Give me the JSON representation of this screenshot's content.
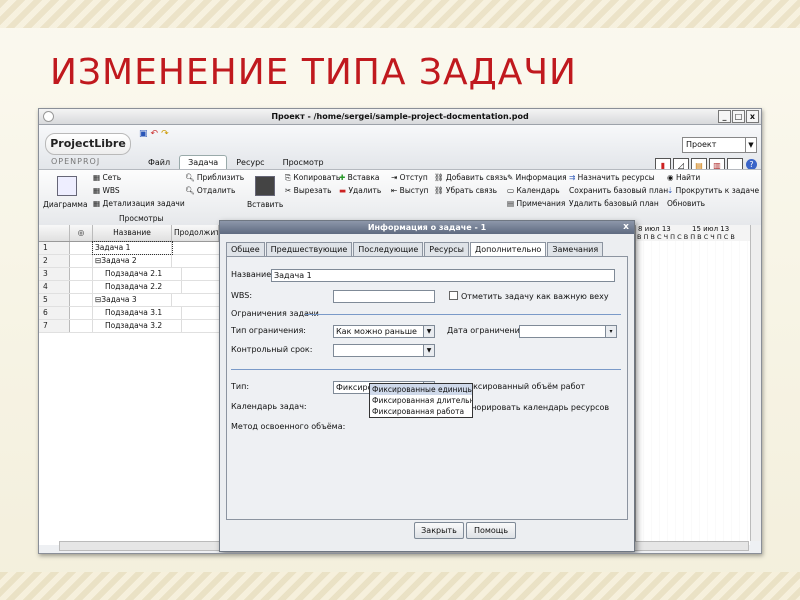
{
  "slide": {
    "title": "ИЗМЕНЕНИЕ ТИПА ЗАДАЧИ"
  },
  "app": {
    "window_title": "Проект - /home/sergei/sample-project-docmentation.pod",
    "logo_text": "ProjectLibre",
    "logo_sub": "OPENPROJ",
    "menu_tabs": [
      "Файл",
      "Задача",
      "Ресурс",
      "Просмотр"
    ],
    "active_menu_tab": "Задача",
    "project_select": "Проект",
    "ribbon": {
      "diagram_label": "Диаграмма",
      "net_label": "Сеть",
      "wbs_label": "WBS",
      "detail_label": "Детализация задачи",
      "views_group": "Просмотры",
      "zoom_in": "Приблизить",
      "zoom_out": "Отдалить",
      "paste": "Вставить",
      "copy": "Копировать",
      "cut": "Вырезать",
      "clipboard_group": "Буфер обмена",
      "insert": "Вставка",
      "delete": "Удалить",
      "indent": "Отступ",
      "outdent": "Выступ",
      "add_link": "Добавить связь",
      "remove_link": "Убрать связь",
      "info": "Информация",
      "calendar": "Календарь",
      "notes": "Примечания",
      "assign_resources": "Назначить ресурсы",
      "save_baseline": "Сохранить базовый план",
      "delete_baseline": "Удалить базовый план",
      "find": "Найти",
      "scroll_to_task": "Прокрутить к задаче",
      "refresh": "Обновить",
      "tasks_group": "Задача"
    },
    "table": {
      "col_name": "Название",
      "col_duration": "Продолжите",
      "rows": [
        {
          "n": "1",
          "name": "Задача 1"
        },
        {
          "n": "2",
          "name": "⊟Задача 2"
        },
        {
          "n": "3",
          "name": "Подзадача 2.1"
        },
        {
          "n": "4",
          "name": "Подзадача 2.2"
        },
        {
          "n": "5",
          "name": "⊟Задача 3"
        },
        {
          "n": "6",
          "name": "Подзадача 3.1"
        },
        {
          "n": "7",
          "name": "Подзадача 3.2"
        }
      ]
    },
    "gantt": {
      "week1": "8 июл 13",
      "week2": "15 июл 13",
      "days": "В П В С Ч П С В П В С Ч П С В"
    }
  },
  "dialog": {
    "title": "Информация о задаче - 1",
    "tabs": [
      "Общее",
      "Предшествующие",
      "Последующие",
      "Ресурсы",
      "Дополнительно",
      "Замечания"
    ],
    "active_tab": "Дополнительно",
    "name_label": "Название:",
    "name_value": "Задача 1",
    "wbs_label": "WBS:",
    "wbs_value": "",
    "milestone_check": "Отметить задачу как важную веху",
    "constraints_section": "Ограничения задачи",
    "constraint_type_label": "Тип ограничения:",
    "constraint_type_value": "Как можно раньше",
    "constraint_date_label": "Дата ограничения:",
    "deadline_label": "Контрольный срок:",
    "type_label": "Тип:",
    "type_value": "Фиксированные едини...",
    "fixed_effort": "Фиксированный объём работ",
    "calendar_label": "Календарь задач:",
    "ignore_calendar": "Игнорировать календарь ресурсов",
    "earned_value_label": "Метод освоенного объёма:",
    "type_options": [
      "Фиксированные единицы",
      "Фиксированная длительнос",
      "Фиксированная работа"
    ],
    "close_button": "Закрыть",
    "help_button": "Помощь"
  }
}
